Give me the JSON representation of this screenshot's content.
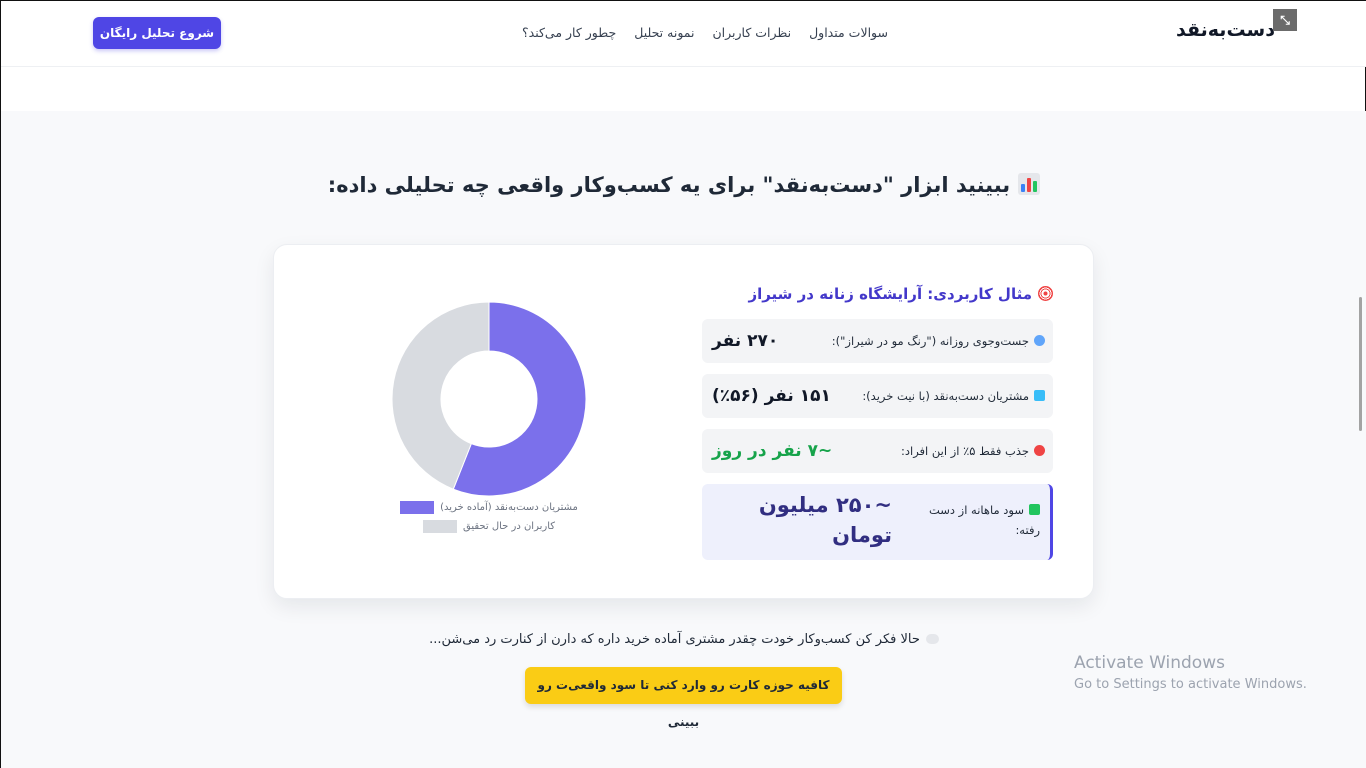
{
  "header": {
    "brand": "دست‌به‌نقد",
    "nav": [
      "چطور کار می‌کند؟",
      "نمونه تحلیل",
      "نظرات کاربران",
      "سوالات متداول"
    ],
    "cta": "شروع تحلیل رایگان"
  },
  "section": {
    "title": "ببینید ابزار \"دست‌به‌نقد\" برای یه کسب‌وکار واقعی چه تحلیلی داده:",
    "example_title": "مثال کاربردی: آرایشگاه زنانه در شیراز",
    "stats": [
      {
        "label": "جست‌وجوی روزانه (\"رنگ مو در شیراز\"):",
        "value": "۲۷۰ نفر"
      },
      {
        "label": "مشتریان دست‌به‌نقد (با نیت خرید):",
        "value": "۱۵۱ نفر (۵۶٪)"
      },
      {
        "label": "جذب فقط ۵٪ از این افراد:",
        "value": "~۷ نفر در روز"
      }
    ],
    "highlight": {
      "label": "سود ماهانه از دست رفته:",
      "value": "~۲۵۰ میلیون تومان"
    },
    "footer_text": "حالا فکر کن کسب‌وکار خودت چقدر مشتری آماده خرید داره که دارن از کنارت رد می‌شن...",
    "cta": "کافیه حوزه کارت رو وارد کنی تا سود واقعی‌ت رو ببینی"
  },
  "chart_data": {
    "type": "pie",
    "categories": [
      "مشتریان دست‌به‌نقد (آماده خرید)",
      "کاربران در حال تحقیق"
    ],
    "values": [
      56,
      44
    ],
    "colors": [
      "#7b70eb",
      "#d8dbe0"
    ],
    "legend_position": "bottom"
  },
  "system": {
    "activate_title": "Activate Windows",
    "activate_sub": "Go to Settings to activate Windows."
  },
  "colors": {
    "primary": "#4f46e5",
    "accent": "#facc15",
    "green": "#16a34a"
  }
}
